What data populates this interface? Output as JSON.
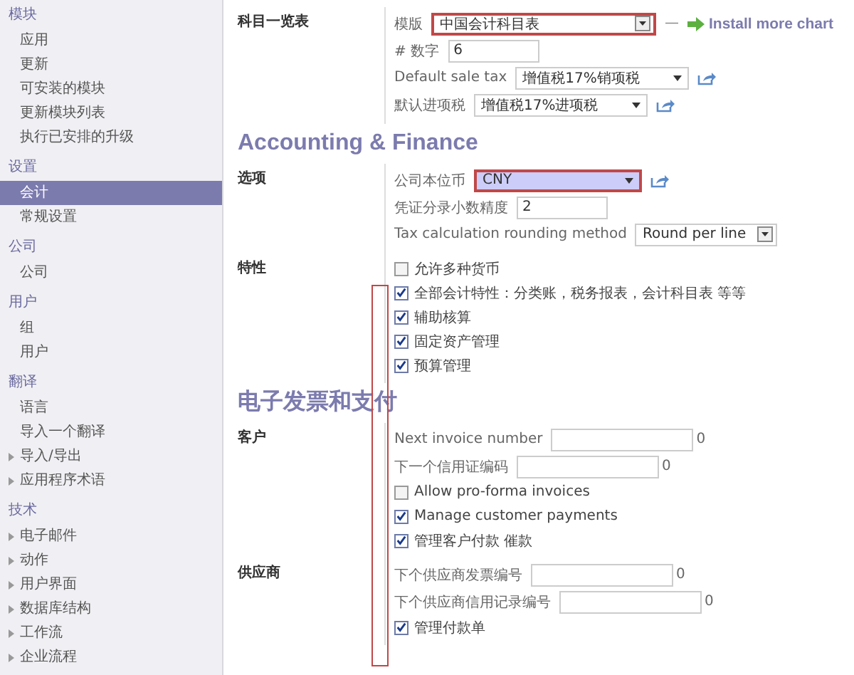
{
  "sidebar": [
    {
      "title": "模块",
      "items": [
        {
          "label": "应用",
          "selected": false,
          "kind": "leaf"
        },
        {
          "label": "更新",
          "selected": false,
          "kind": "leaf"
        },
        {
          "label": "可安装的模块",
          "selected": false,
          "kind": "leaf"
        },
        {
          "label": "更新模块列表",
          "selected": false,
          "kind": "leaf"
        },
        {
          "label": "执行已安排的升级",
          "selected": false,
          "kind": "leaf"
        }
      ]
    },
    {
      "title": "设置",
      "items": [
        {
          "label": "会计",
          "selected": true,
          "kind": "leaf"
        },
        {
          "label": "常规设置",
          "selected": false,
          "kind": "leaf"
        }
      ]
    },
    {
      "title": "公司",
      "items": [
        {
          "label": "公司",
          "selected": false,
          "kind": "leaf"
        }
      ]
    },
    {
      "title": "用户",
      "items": [
        {
          "label": "组",
          "selected": false,
          "kind": "leaf"
        },
        {
          "label": "用户",
          "selected": false,
          "kind": "leaf"
        }
      ]
    },
    {
      "title": "翻译",
      "items": [
        {
          "label": "语言",
          "selected": false,
          "kind": "leaf"
        },
        {
          "label": "导入一个翻译",
          "selected": false,
          "kind": "leaf"
        },
        {
          "label": "导入/导出",
          "selected": false,
          "kind": "folder"
        },
        {
          "label": "应用程序术语",
          "selected": false,
          "kind": "folder"
        }
      ]
    },
    {
      "title": "技术",
      "items": [
        {
          "label": "电子邮件",
          "selected": false,
          "kind": "folder"
        },
        {
          "label": "动作",
          "selected": false,
          "kind": "folder"
        },
        {
          "label": "用户界面",
          "selected": false,
          "kind": "folder"
        },
        {
          "label": "数据库结构",
          "selected": false,
          "kind": "folder"
        },
        {
          "label": "工作流",
          "selected": false,
          "kind": "folder"
        },
        {
          "label": "企业流程",
          "selected": false,
          "kind": "folder"
        }
      ]
    }
  ],
  "main": [
    {
      "kind": "group",
      "label": "科目一览表",
      "rows": [
        {
          "kind": "combo",
          "label": "模版",
          "value": "中国会计科目表",
          "highlighted": true,
          "separator": "—",
          "link": "Install more chart"
        },
        {
          "kind": "input",
          "label": "# 数字",
          "value": "6"
        },
        {
          "kind": "select",
          "label": "Default sale tax",
          "value": "增值税17%销项税",
          "highlighted": false
        },
        {
          "kind": "select",
          "label": "默认进项税",
          "value": "增值税17%进项税",
          "highlighted": false
        }
      ]
    },
    {
      "kind": "heading",
      "text": "Accounting & Finance"
    },
    {
      "kind": "group",
      "label": "选项",
      "rows": [
        {
          "kind": "select",
          "label": "公司本位币",
          "value": "CNY",
          "highlighted": true,
          "filled": true
        },
        {
          "kind": "input",
          "label": "凭证分录小数精度",
          "value": "2"
        },
        {
          "kind": "combo",
          "label": "Tax calculation rounding method",
          "value": "Round per line",
          "highlighted": false
        }
      ]
    },
    {
      "kind": "group",
      "label": "特性",
      "rows": [
        {
          "kind": "checkbox",
          "label": "允许多种货币",
          "checked": false
        },
        {
          "kind": "checkbox",
          "label": "全部会计特性：分类账，税务报表，会计科目表 等等",
          "checked": true
        },
        {
          "kind": "checkbox",
          "label": "辅助核算",
          "checked": true
        },
        {
          "kind": "checkbox",
          "label": "固定资产管理",
          "checked": true
        },
        {
          "kind": "checkbox",
          "label": "预算管理",
          "checked": true
        }
      ]
    },
    {
      "kind": "heading",
      "text": "电子发票和支付"
    },
    {
      "kind": "group",
      "label": "客户",
      "rows": [
        {
          "kind": "input",
          "label": "Next invoice number",
          "value": "",
          "suffix": "0"
        },
        {
          "kind": "input",
          "label": "下一个信用证编码",
          "value": "",
          "suffix": "0"
        },
        {
          "kind": "checkbox",
          "label": "Allow pro-forma invoices",
          "checked": false
        },
        {
          "kind": "checkbox",
          "label": "Manage customer payments",
          "checked": true
        },
        {
          "kind": "checkbox",
          "label": "管理客户付款 催款",
          "checked": true
        }
      ]
    },
    {
      "kind": "group",
      "label": "供应商",
      "rows": [
        {
          "kind": "input",
          "label": "下个供应商发票编号",
          "value": "",
          "suffix": "0"
        },
        {
          "kind": "input",
          "label": "下个供应商信用记录编号",
          "value": "",
          "suffix": "0"
        },
        {
          "kind": "checkbox",
          "label": "管理付款单",
          "checked": true
        }
      ]
    }
  ]
}
